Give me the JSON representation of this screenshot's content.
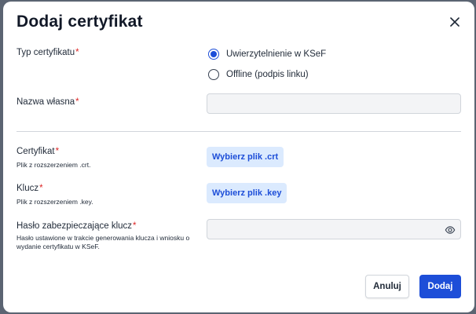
{
  "dialog": {
    "title": "Dodaj certyfikat"
  },
  "form": {
    "cert_type": {
      "label": "Typ certyfikatu",
      "required_mark": "*",
      "options": [
        {
          "label": "Uwierzytelnienie w KSeF",
          "checked": true
        },
        {
          "label": "Offline (podpis linku)",
          "checked": false
        }
      ]
    },
    "custom_name": {
      "label": "Nazwa własna",
      "required_mark": "*",
      "value": ""
    },
    "certificate": {
      "label": "Certyfikat",
      "required_mark": "*",
      "hint": "Plik z rozszerzeniem .crt.",
      "button_label": "Wybierz plik .crt"
    },
    "key": {
      "label": "Klucz",
      "required_mark": "*",
      "hint": "Plik z rozszerzeniem .key.",
      "button_label": "Wybierz plik .key"
    },
    "key_password": {
      "label": "Hasło zabezpieczające klucz",
      "required_mark": "*",
      "hint": "Hasło ustawione w trakcie generowania klucza i wniosku o wydanie certyfikatu w KSeF.",
      "value": ""
    }
  },
  "footer": {
    "cancel_label": "Anuluj",
    "submit_label": "Dodaj"
  },
  "colors": {
    "accent": "#1d4ed8",
    "accent_light": "#dbeafe",
    "required": "#dc2626",
    "overlay": "#5b6472"
  },
  "icons": {
    "close": "close-icon",
    "password_toggle": "eye-icon"
  }
}
